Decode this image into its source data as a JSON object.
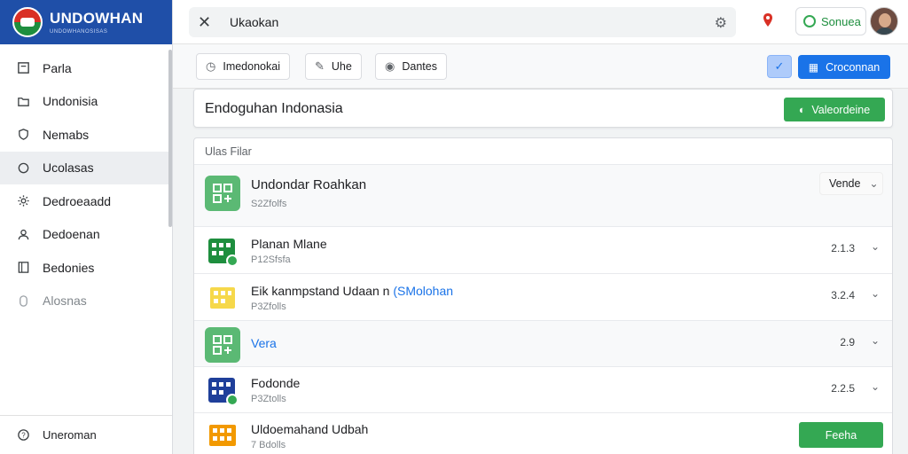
{
  "brand": {
    "name": "UNDOWHAN",
    "subtitle": "UNDOWHANOSISAS"
  },
  "sidebar": {
    "items": [
      {
        "label": "Parla",
        "icon": "square-outline-icon"
      },
      {
        "label": "Undonisia",
        "icon": "folder-icon"
      },
      {
        "label": "Nemabs",
        "icon": "shield-icon"
      },
      {
        "label": "Ucolasas",
        "icon": "circle-icon"
      },
      {
        "label": "Dedroeaadd",
        "icon": "gear-icon"
      },
      {
        "label": "Dedoenan",
        "icon": "user-icon"
      },
      {
        "label": "Bedonies",
        "icon": "book-icon"
      },
      {
        "label": "Alosnas",
        "icon": "toggle-icon"
      }
    ],
    "footer": {
      "label": "Uneroman",
      "icon": "help-icon"
    }
  },
  "topbar": {
    "search_value": "Ukaokan",
    "user_chip": "Sonuea"
  },
  "toolbar": {
    "buttons": [
      {
        "label": "Imedonokai",
        "icon": "clock-icon"
      },
      {
        "label": "Uhe",
        "icon": "edit-icon"
      },
      {
        "label": "Dantes",
        "icon": "eye-icon"
      }
    ],
    "primary": "Croconnan"
  },
  "title_card": {
    "title": "Endoguhan Indonasia",
    "action": "Valeordeine"
  },
  "list": {
    "header": "Ulas Filar",
    "rows": [
      {
        "name": "Undondar Roahkan",
        "link": "",
        "meta": "S2Zfolfs",
        "value": "",
        "select": "Vende"
      },
      {
        "name": "Planan Mlane",
        "link": "",
        "meta": "P12Sfsfa",
        "value": "2.1.3"
      },
      {
        "name": "Eik kanmpstand Udaan n",
        "link": "(SMolohan",
        "meta": "P3Zfolls",
        "value": "3.2.4"
      },
      {
        "name": "",
        "link": "Vera",
        "meta": "",
        "value": "2.9"
      },
      {
        "name": "Fodonde",
        "link": "",
        "meta": "P3Ztolls",
        "value": "2.2.5"
      },
      {
        "name": "Uldoemahand Udbah",
        "link": "",
        "meta": "7 Bdolls",
        "value": "",
        "button": "Feeha"
      }
    ]
  },
  "colors": {
    "brand_blue": "#1f4fa8",
    "primary_blue": "#1a73e8",
    "accent_green": "#34a853",
    "alert_red": "#d93025"
  }
}
